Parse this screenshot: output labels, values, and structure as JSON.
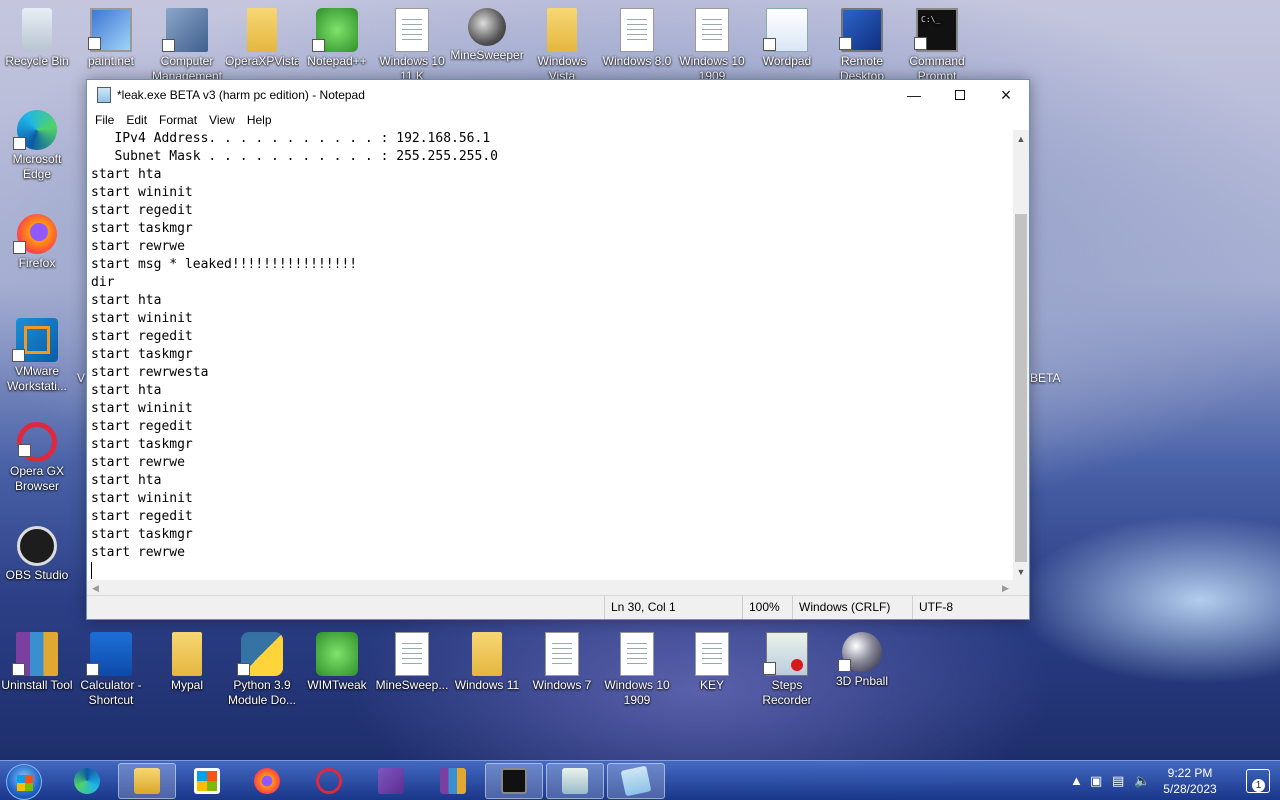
{
  "desktop_icons": [
    {
      "label": "Recycle Bin",
      "icon": "recycle-bin-icon"
    },
    {
      "label": "paint.net",
      "icon": "paint-net-icon"
    },
    {
      "label": "Computer Management",
      "icon": "computer-management-icon"
    },
    {
      "label": "OperaXPVista",
      "icon": "folder-icon"
    },
    {
      "label": "Notepad++",
      "icon": "notepad-plus-plus-icon"
    },
    {
      "label": "Windows 10 11 K",
      "icon": "text-file-icon"
    },
    {
      "label": "MineSweeper",
      "icon": "minesweeper-icon"
    },
    {
      "label": "Windows Vista",
      "icon": "folder-icon"
    },
    {
      "label": "Windows 8.0",
      "icon": "text-file-icon"
    },
    {
      "label": "Windows 10 1909",
      "icon": "text-file-icon"
    },
    {
      "label": "Wordpad",
      "icon": "wordpad-icon"
    },
    {
      "label": "Remote Desktop",
      "icon": "remote-desktop-icon"
    },
    {
      "label": "Command Prompt",
      "icon": "command-prompt-icon"
    },
    {
      "label": "Microsoft Edge",
      "icon": "edge-icon"
    },
    {
      "label": "Firefox",
      "icon": "firefox-icon"
    },
    {
      "label": "VMware Workstati...",
      "icon": "vmware-icon"
    },
    {
      "label": "Opera GX Browser",
      "icon": "opera-gx-icon"
    },
    {
      "label": "OBS Studio",
      "icon": "obs-studio-icon"
    },
    {
      "label": "Uninstall Tool",
      "icon": "uninstall-tool-icon"
    },
    {
      "label": "Calculator - Shortcut",
      "icon": "calculator-icon"
    },
    {
      "label": "Mypal",
      "icon": "folder-icon"
    },
    {
      "label": "Python 3.9 Module Do...",
      "icon": "python-icon"
    },
    {
      "label": "WIMTweak",
      "icon": "wimtweak-icon"
    },
    {
      "label": "MineSweep...",
      "icon": "minesweeper-file-icon"
    },
    {
      "label": "Windows 11",
      "icon": "folder-icon"
    },
    {
      "label": "Windows 7",
      "icon": "text-file-icon"
    },
    {
      "label": "Windows 10 1909",
      "icon": "text-file-icon"
    },
    {
      "label": "KEY",
      "icon": "text-file-icon"
    },
    {
      "label": "Steps Recorder",
      "icon": "steps-recorder-icon"
    },
    {
      "label": "3D Pnball",
      "icon": "pinball-icon"
    }
  ],
  "stray_labels": {
    "left": "V",
    "right": "BETA"
  },
  "notepad": {
    "title": "*leak.exe BETA v3 (harm pc edition) - Notepad",
    "menu": [
      "File",
      "Edit",
      "Format",
      "View",
      "Help"
    ],
    "content": "   IPv4 Address. . . . . . . . . . . : 192.168.56.1\n   Subnet Mask . . . . . . . . . . . : 255.255.255.0\nstart hta\nstart wininit\nstart regedit\nstart taskmgr\nstart rewrwe\nstart msg * leaked!!!!!!!!!!!!!!!!\ndir\nstart hta\nstart wininit\nstart regedit\nstart taskmgr\nstart rewrwesta\nstart hta\nstart wininit\nstart regedit\nstart taskmgr\nstart rewrwe\nstart hta\nstart wininit\nstart regedit\nstart taskmgr\nstart rewrwe",
    "status": {
      "position": "Ln 30, Col 1",
      "zoom": "100%",
      "line_ending": "Windows (CRLF)",
      "encoding": "UTF-8"
    },
    "scroll_position_fraction": 0.19
  },
  "taskbar": {
    "items": [
      "Microsoft Edge",
      "File Explorer",
      "Microsoft Store",
      "Firefox",
      "Opera GX",
      "Visual Studio",
      "WinRAR",
      "Command Prompt",
      "Notepad (paint)",
      "Notepad"
    ],
    "clock_time": "9:22 PM",
    "clock_date": "5/28/2023",
    "notification_count": "1"
  },
  "colors": {
    "taskbar": "#2a4fa8",
    "window_border": "#6f8fb8"
  }
}
